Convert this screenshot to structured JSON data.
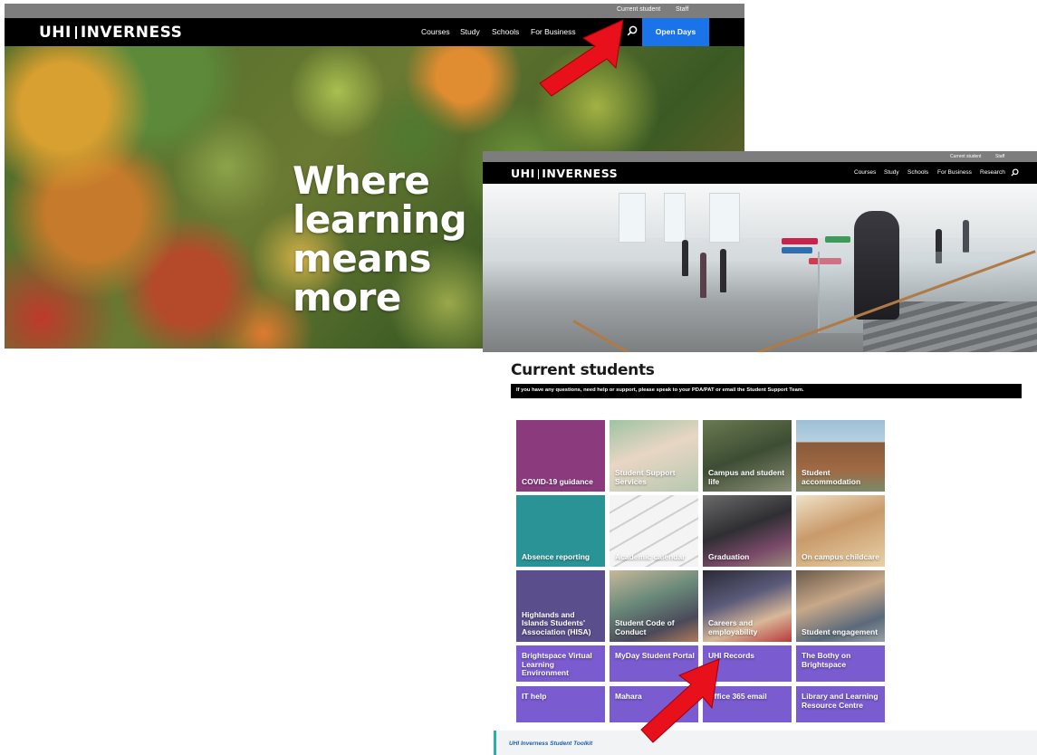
{
  "homepage": {
    "utility_links": [
      "Current student",
      "Staff"
    ],
    "logo": {
      "left": "UHI",
      "right": "INVERNESS"
    },
    "nav_links": [
      "Courses",
      "Study",
      "Schools",
      "For Business"
    ],
    "search_icon": "search-icon",
    "cta_label": "Open Days",
    "headline": [
      "Where",
      "learning",
      "means",
      "more"
    ]
  },
  "students_page": {
    "utility_links": [
      "Current student",
      "Staff"
    ],
    "logo": {
      "left": "UHI",
      "right": "INVERNESS"
    },
    "nav_links": [
      "Courses",
      "Study",
      "Schools",
      "For Business",
      "Research"
    ],
    "search_icon": "search-icon",
    "title": "Current students",
    "notice": "If you have any questions, need help or support, please speak to your PDA/PAT or email the Student Support Team.",
    "tiles": [
      {
        "label": "COVID-19 guidance",
        "color": "#8b3a7e"
      },
      {
        "label": "Student Support Services"
      },
      {
        "label": "Campus and student life"
      },
      {
        "label": "Student accommodation"
      },
      {
        "label": "Absence reporting",
        "color": "#2a9396"
      },
      {
        "label": "Academic calendar"
      },
      {
        "label": "Graduation"
      },
      {
        "label": "On campus childcare"
      },
      {
        "label": "Highlands and Islands Students' Association (HISA)",
        "color": "#5a4f8c"
      },
      {
        "label": "Student Code of Conduct"
      },
      {
        "label": "Careers and employability"
      },
      {
        "label": "Student engagement"
      },
      {
        "label": "Brightspace Virtual Learning Environment",
        "color": "#7a5bd0"
      },
      {
        "label": "MyDay Student Portal",
        "color": "#7a5bd0"
      },
      {
        "label": "UHI Records",
        "color": "#7a5bd0"
      },
      {
        "label": "The Bothy on Brightspace",
        "color": "#7a5bd0"
      },
      {
        "label": "IT help",
        "color": "#7a5bd0"
      },
      {
        "label": "Mahara",
        "color": "#7a5bd0"
      },
      {
        "label": "Office 365 email",
        "color": "#7a5bd0"
      },
      {
        "label": "Library and Learning Resource Centre",
        "color": "#7a5bd0"
      }
    ],
    "toolkit_link": "UHI Inverness Student Toolkit"
  },
  "annotations": {
    "arrow_color": "#e8101a",
    "arrows": [
      "arrow-to-current-student-link",
      "arrow-to-uhi-records-tile"
    ]
  },
  "colors": {
    "topbar": "#7d7d7d",
    "nav": "#000000",
    "cta": "#1a73e8",
    "toolkit_accent": "#2ab0a5"
  }
}
